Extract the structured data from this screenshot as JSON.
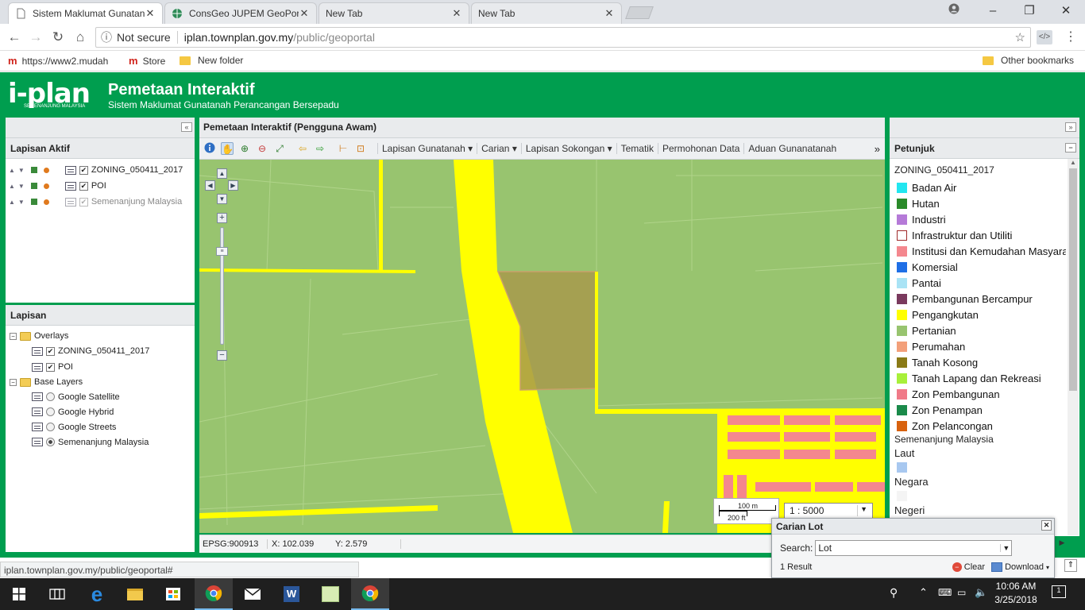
{
  "browser": {
    "tabs": [
      {
        "title": "Sistem Maklumat Gunatanah Perancangan Bersepadu",
        "active": true
      },
      {
        "title": "ConsGeo JUPEM GeoPortal",
        "active": false
      },
      {
        "title": "New Tab",
        "active": false
      },
      {
        "title": "New Tab",
        "active": false
      }
    ],
    "security": "Not secure",
    "url_host": "iplan.townplan.gov.my",
    "url_path": "/public/geoportal",
    "bookmarks": [
      {
        "label": "https://www2.mudah",
        "icon": "m-icon"
      },
      {
        "label": "Store",
        "icon": "m-icon"
      },
      {
        "label": "New folder",
        "icon": "folder-icon"
      }
    ],
    "other_bookmarks": "Other bookmarks",
    "status_url": "iplan.townplan.gov.my/public/geoportal#"
  },
  "app": {
    "logo_text": "i-plan",
    "logo_sub": "SEMENANJUNG MALAYSIA",
    "title": "Pemetaan Interaktif",
    "subtitle": "Sistem Maklumat Gunatanah Perancangan Bersepadu"
  },
  "left": {
    "active_title": "Lapisan Aktif",
    "active_layers": [
      {
        "label": "ZONING_050411_2017",
        "checked": true
      },
      {
        "label": "POI",
        "checked": true
      },
      {
        "label": "Semenanjung Malaysia",
        "checked": true,
        "dimmed": true
      }
    ],
    "layers_title": "Lapisan",
    "overlays_label": "Overlays",
    "overlays": [
      "ZONING_050411_2017",
      "POI"
    ],
    "base_label": "Base Layers",
    "base_layers": [
      {
        "label": "Google Satellite",
        "selected": false
      },
      {
        "label": "Google Hybrid",
        "selected": false
      },
      {
        "label": "Google Streets",
        "selected": false
      },
      {
        "label": "Semenanjung Malaysia",
        "selected": true
      }
    ]
  },
  "center": {
    "title": "Pemetaan Interaktif (Pengguna Awam)",
    "menus": [
      "Lapisan Gunatanah",
      "Carian",
      "Lapisan Sokongan",
      "Tematik",
      "Permohonan Data",
      "Aduan Gunanatanah"
    ],
    "dropdown_menus": [
      true,
      true,
      true,
      false,
      false,
      false
    ],
    "scale_m": "100 m",
    "scale_ft": "200 ft",
    "scale_ratio": "1 : 5000",
    "epsg": "EPSG:900913",
    "x": "X: 102.039",
    "y": "Y: 2.579"
  },
  "legend": {
    "title": "Petunjuk",
    "layer": "ZONING_050411_2017",
    "items": [
      {
        "label": "Badan Air",
        "color": "#22e6f0"
      },
      {
        "label": "Hutan",
        "color": "#2a8a2a"
      },
      {
        "label": "Industri",
        "color": "#b57ad8"
      },
      {
        "label": "Infrastruktur dan Utiliti",
        "color": "#ffffff",
        "border": "#a02a2a"
      },
      {
        "label": "Institusi dan Kemudahan Masyarakat",
        "color": "#f4878e"
      },
      {
        "label": "Komersial",
        "color": "#1f6fe6"
      },
      {
        "label": "Pantai",
        "color": "#a9e3f5"
      },
      {
        "label": "Pembangunan Bercampur",
        "color": "#7a3a5e"
      },
      {
        "label": "Pengangkutan",
        "color": "#ffff00"
      },
      {
        "label": "Pertanian",
        "color": "#98c46f"
      },
      {
        "label": "Perumahan",
        "color": "#f3a07a"
      },
      {
        "label": "Tanah Kosong",
        "color": "#8a7a16"
      },
      {
        "label": "Tanah Lapang dan Rekreasi",
        "color": "#a8f03a"
      },
      {
        "label": "Zon Pembangunan",
        "color": "#f07a88"
      },
      {
        "label": "Zon Penampan",
        "color": "#1a8a4a"
      },
      {
        "label": "Zon Pelancongan",
        "color": "#d8620e"
      }
    ],
    "base_title": "Semenanjung Malaysia",
    "laut": "Laut",
    "laut_color": "#a8c8f0",
    "negara": "Negara",
    "negeri": "Negeri"
  },
  "carian": {
    "title": "Carian Lot",
    "search_label": "Search:",
    "search_value": "Lot",
    "result": "1 Result",
    "clear": "Clear",
    "download": "Download"
  },
  "taskbar": {
    "time": "10:06 AM",
    "date": "3/25/2018",
    "notifications": "1"
  }
}
